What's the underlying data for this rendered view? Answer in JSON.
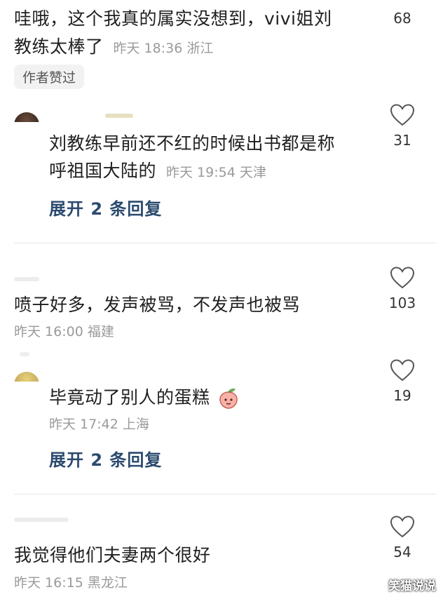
{
  "comments": [
    {
      "text_line1": "哇哦，这个我真的属实没想到，vivi姐刘",
      "text_line2": "教练太棒了",
      "time": "昨天 18:36 浙江",
      "likes": "68",
      "badge": "作者赞过"
    },
    {
      "text_line1": "刘教练早前还不红的时候出书都是称",
      "text_line2": "呼祖国大陆的",
      "time": "昨天 19:54 天津",
      "likes": "31",
      "expand": "展开 2 条回复"
    },
    {
      "text": "喷子好多，发声被骂，不发声也被骂",
      "time": "昨天 16:00 福建",
      "likes": "103"
    },
    {
      "text": "毕竟动了别人的蛋糕",
      "time": "昨天 17:42 上海",
      "likes": "19",
      "expand": "展开 2 条回复"
    },
    {
      "text": "我觉得他们夫妻两个很好",
      "time": "昨天 16:15 黑龙江",
      "likes": "54"
    }
  ],
  "watermark": "笑猫说说"
}
